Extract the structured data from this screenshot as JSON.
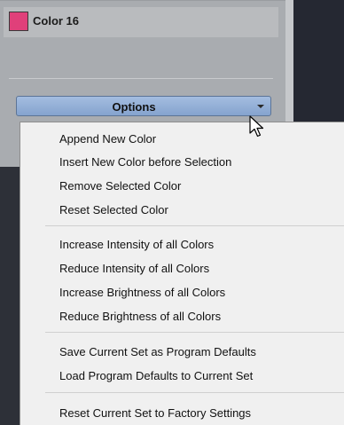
{
  "panel": {
    "color_name": "Color 16",
    "swatch_color": "#e0407a"
  },
  "options_button": {
    "label": "Options",
    "accent_color": "#85a3ce"
  },
  "menu": {
    "items": [
      "Append New Color",
      "Insert New Color before Selection",
      "Remove Selected Color",
      "Reset Selected Color",
      "Increase Intensity of all Colors",
      "Reduce Intensity of all Colors",
      "Increase Brightness of all Colors",
      "Reduce Brightness of all Colors",
      "Save Current Set as Program Defaults",
      "Load Program Defaults to Current Set",
      "Reset Current Set to Factory Settings"
    ]
  }
}
